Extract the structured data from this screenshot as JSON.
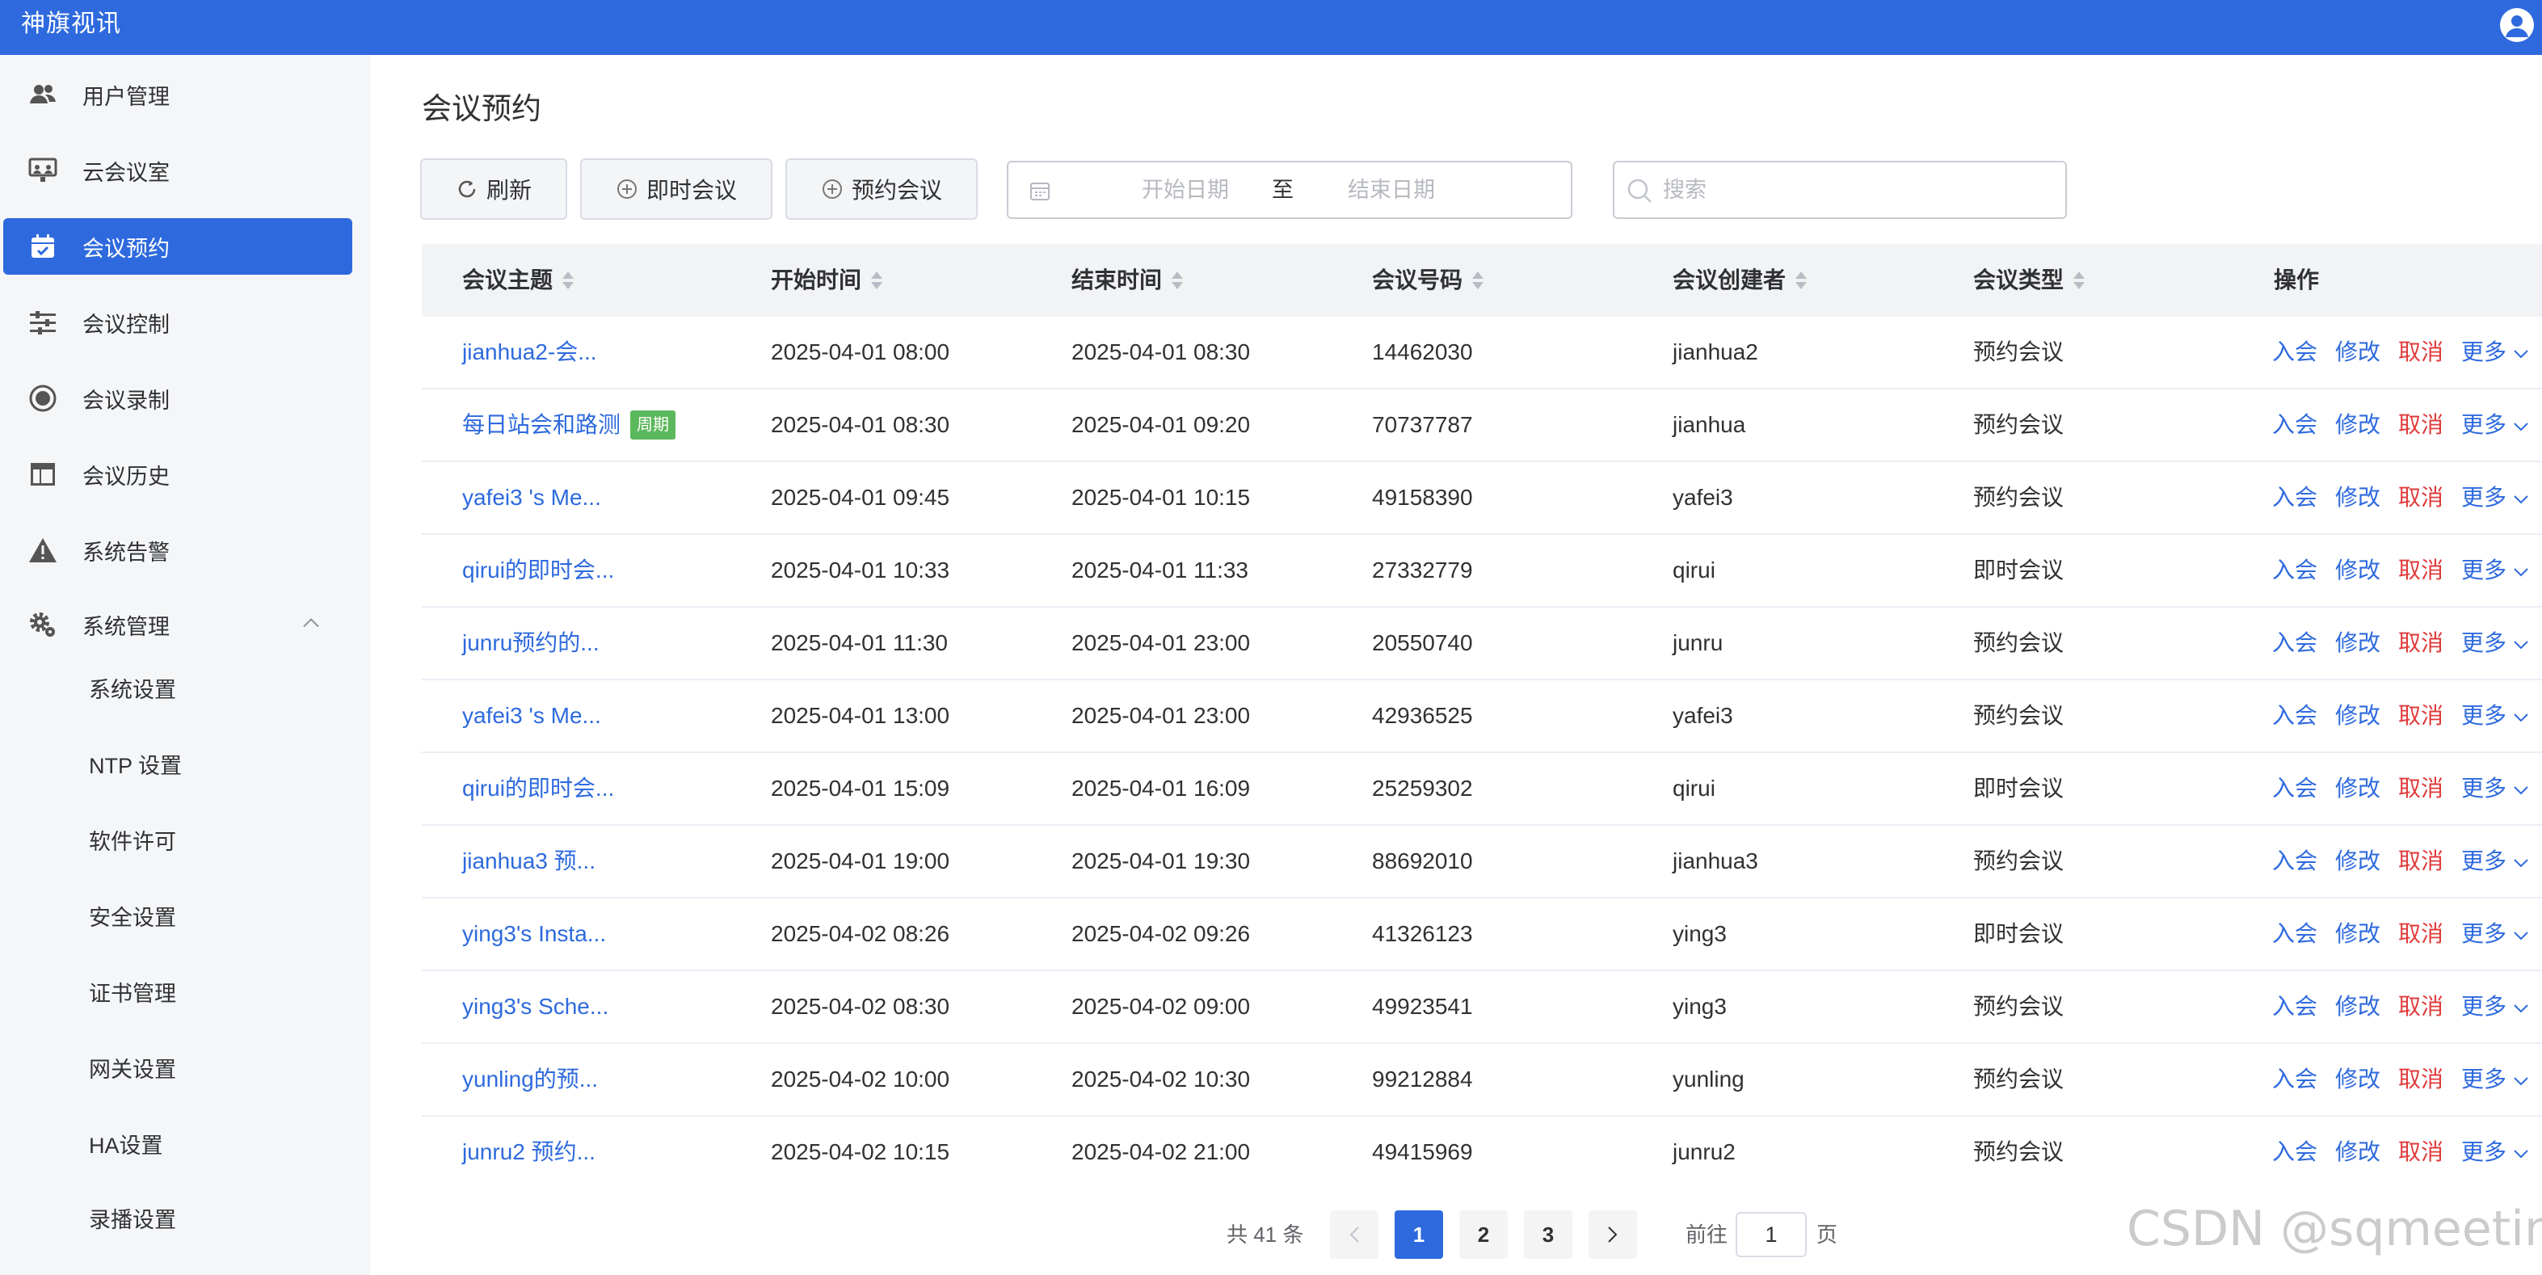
{
  "app": {
    "brand": "神旗视讯"
  },
  "sidebar": {
    "items": [
      {
        "label": "用户管理",
        "icon": "users-icon"
      },
      {
        "label": "云会议室",
        "icon": "meeting-room-icon"
      },
      {
        "label": "会议预约",
        "icon": "calendar-check-icon",
        "active": true
      },
      {
        "label": "会议控制",
        "icon": "sliders-icon"
      },
      {
        "label": "会议录制",
        "icon": "record-icon"
      },
      {
        "label": "会议历史",
        "icon": "history-table-icon"
      },
      {
        "label": "系统告警",
        "icon": "warning-icon"
      },
      {
        "label": "系统管理",
        "icon": "gear-icon",
        "expanded": true
      }
    ],
    "subitems": [
      {
        "label": "系统设置"
      },
      {
        "label": "NTP 设置"
      },
      {
        "label": "软件许可"
      },
      {
        "label": "安全设置"
      },
      {
        "label": "证书管理"
      },
      {
        "label": "网关设置"
      },
      {
        "label": "HA设置"
      },
      {
        "label": "录播设置"
      }
    ]
  },
  "main": {
    "title": "会议预约",
    "toolbar": {
      "refresh": "刷新",
      "instant": "即时会议",
      "schedule": "预约会议"
    },
    "daterange": {
      "start_placeholder": "开始日期",
      "separator": "至",
      "end_placeholder": "结束日期"
    },
    "search": {
      "placeholder": "搜索"
    }
  },
  "table": {
    "columns": [
      "会议主题",
      "开始时间",
      "结束时间",
      "会议号码",
      "会议创建者",
      "会议类型",
      "操作"
    ],
    "actions": {
      "join": "入会",
      "edit": "修改",
      "cancel": "取消",
      "more": "更多"
    },
    "rows": [
      {
        "subject": "jianhua2-会...",
        "start": "2025-04-01 08:00",
        "end": "2025-04-01 08:30",
        "number": "14462030",
        "creator": "jianhua2",
        "type": "预约会议",
        "tag": ""
      },
      {
        "subject": "每日站会和路测",
        "start": "2025-04-01 08:30",
        "end": "2025-04-01 09:20",
        "number": "70737787",
        "creator": "jianhua",
        "type": "预约会议",
        "tag": "周期"
      },
      {
        "subject": "yafei3 's Me...",
        "start": "2025-04-01 09:45",
        "end": "2025-04-01 10:15",
        "number": "49158390",
        "creator": "yafei3",
        "type": "预约会议",
        "tag": ""
      },
      {
        "subject": "qirui的即时会...",
        "start": "2025-04-01 10:33",
        "end": "2025-04-01 11:33",
        "number": "27332779",
        "creator": "qirui",
        "type": "即时会议",
        "tag": ""
      },
      {
        "subject": "junru预约的...",
        "start": "2025-04-01 11:30",
        "end": "2025-04-01 23:00",
        "number": "20550740",
        "creator": "junru",
        "type": "预约会议",
        "tag": ""
      },
      {
        "subject": "yafei3 's Me...",
        "start": "2025-04-01 13:00",
        "end": "2025-04-01 23:00",
        "number": "42936525",
        "creator": "yafei3",
        "type": "预约会议",
        "tag": ""
      },
      {
        "subject": "qirui的即时会...",
        "start": "2025-04-01 15:09",
        "end": "2025-04-01 16:09",
        "number": "25259302",
        "creator": "qirui",
        "type": "即时会议",
        "tag": ""
      },
      {
        "subject": "jianhua3 预...",
        "start": "2025-04-01 19:00",
        "end": "2025-04-01 19:30",
        "number": "88692010",
        "creator": "jianhua3",
        "type": "预约会议",
        "tag": ""
      },
      {
        "subject": "ying3's Insta...",
        "start": "2025-04-02 08:26",
        "end": "2025-04-02 09:26",
        "number": "41326123",
        "creator": "ying3",
        "type": "即时会议",
        "tag": ""
      },
      {
        "subject": "ying3's Sche...",
        "start": "2025-04-02 08:30",
        "end": "2025-04-02 09:00",
        "number": "49923541",
        "creator": "ying3",
        "type": "预约会议",
        "tag": ""
      },
      {
        "subject": "yunling的预...",
        "start": "2025-04-02 10:00",
        "end": "2025-04-02 10:30",
        "number": "99212884",
        "creator": "yunling",
        "type": "预约会议",
        "tag": ""
      },
      {
        "subject": "junru2 预约...",
        "start": "2025-04-02 10:15",
        "end": "2025-04-02 21:00",
        "number": "49415969",
        "creator": "junru2",
        "type": "预约会议",
        "tag": ""
      }
    ]
  },
  "pagination": {
    "total": "共 41 条",
    "pages": [
      "1",
      "2",
      "3"
    ],
    "current": "1",
    "goto_label": "前往",
    "goto_value": "1",
    "page_suffix": "页"
  },
  "watermark": "CSDN @sqmeeting",
  "colors": {
    "primary": "#2e6ade",
    "danger": "#e03a3a",
    "tag": "#5cb85c",
    "sidebar_bg": "#f5f6f8"
  }
}
